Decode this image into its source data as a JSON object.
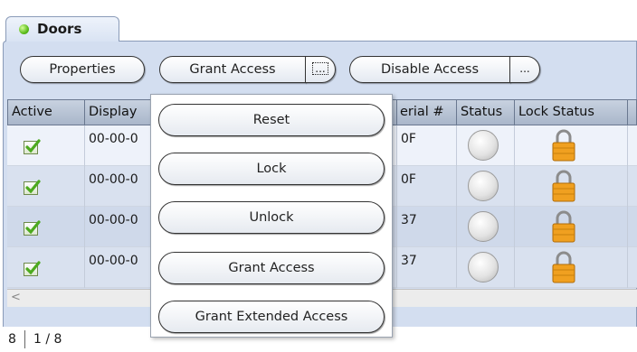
{
  "tab": {
    "label": "Doors",
    "indicator_color": "#5cbc1c"
  },
  "toolbar": {
    "properties_label": "Properties",
    "grant_access_label": "Grant Access",
    "more_label_1": "...",
    "disable_access_label": "Disable Access",
    "more_label_2": "..."
  },
  "table": {
    "columns": [
      "Active",
      "Display",
      "Serial #",
      "Status",
      "Lock Status"
    ],
    "header_visible": [
      "Active",
      "Display",
      "erial #",
      "Status",
      "Lock Status"
    ],
    "rows": [
      {
        "active": true,
        "display": "00-00-0",
        "serial": "0F",
        "status_icon": "status-off-icon",
        "lock_icon": "lock-icon"
      },
      {
        "active": true,
        "display": "00-00-0",
        "serial": "0F",
        "status_icon": "status-off-icon",
        "lock_icon": "lock-icon"
      },
      {
        "active": true,
        "display": "00-00-0",
        "serial": "37",
        "status_icon": "status-off-icon",
        "lock_icon": "lock-icon"
      },
      {
        "active": true,
        "display": "00-00-0",
        "serial": "37",
        "status_icon": "status-off-icon",
        "lock_icon": "lock-icon"
      }
    ]
  },
  "popup_menu": {
    "items": [
      "Reset",
      "Lock",
      "Unlock",
      "Grant Access",
      "Grant Extended Access"
    ]
  },
  "scrollbar": {
    "left_arrow": "<"
  },
  "statusbar": {
    "count": "8",
    "pager": "1 / 8"
  },
  "colors": {
    "panel": "#d3def0",
    "lock": "#f0a020",
    "check": "#4caa1e"
  }
}
